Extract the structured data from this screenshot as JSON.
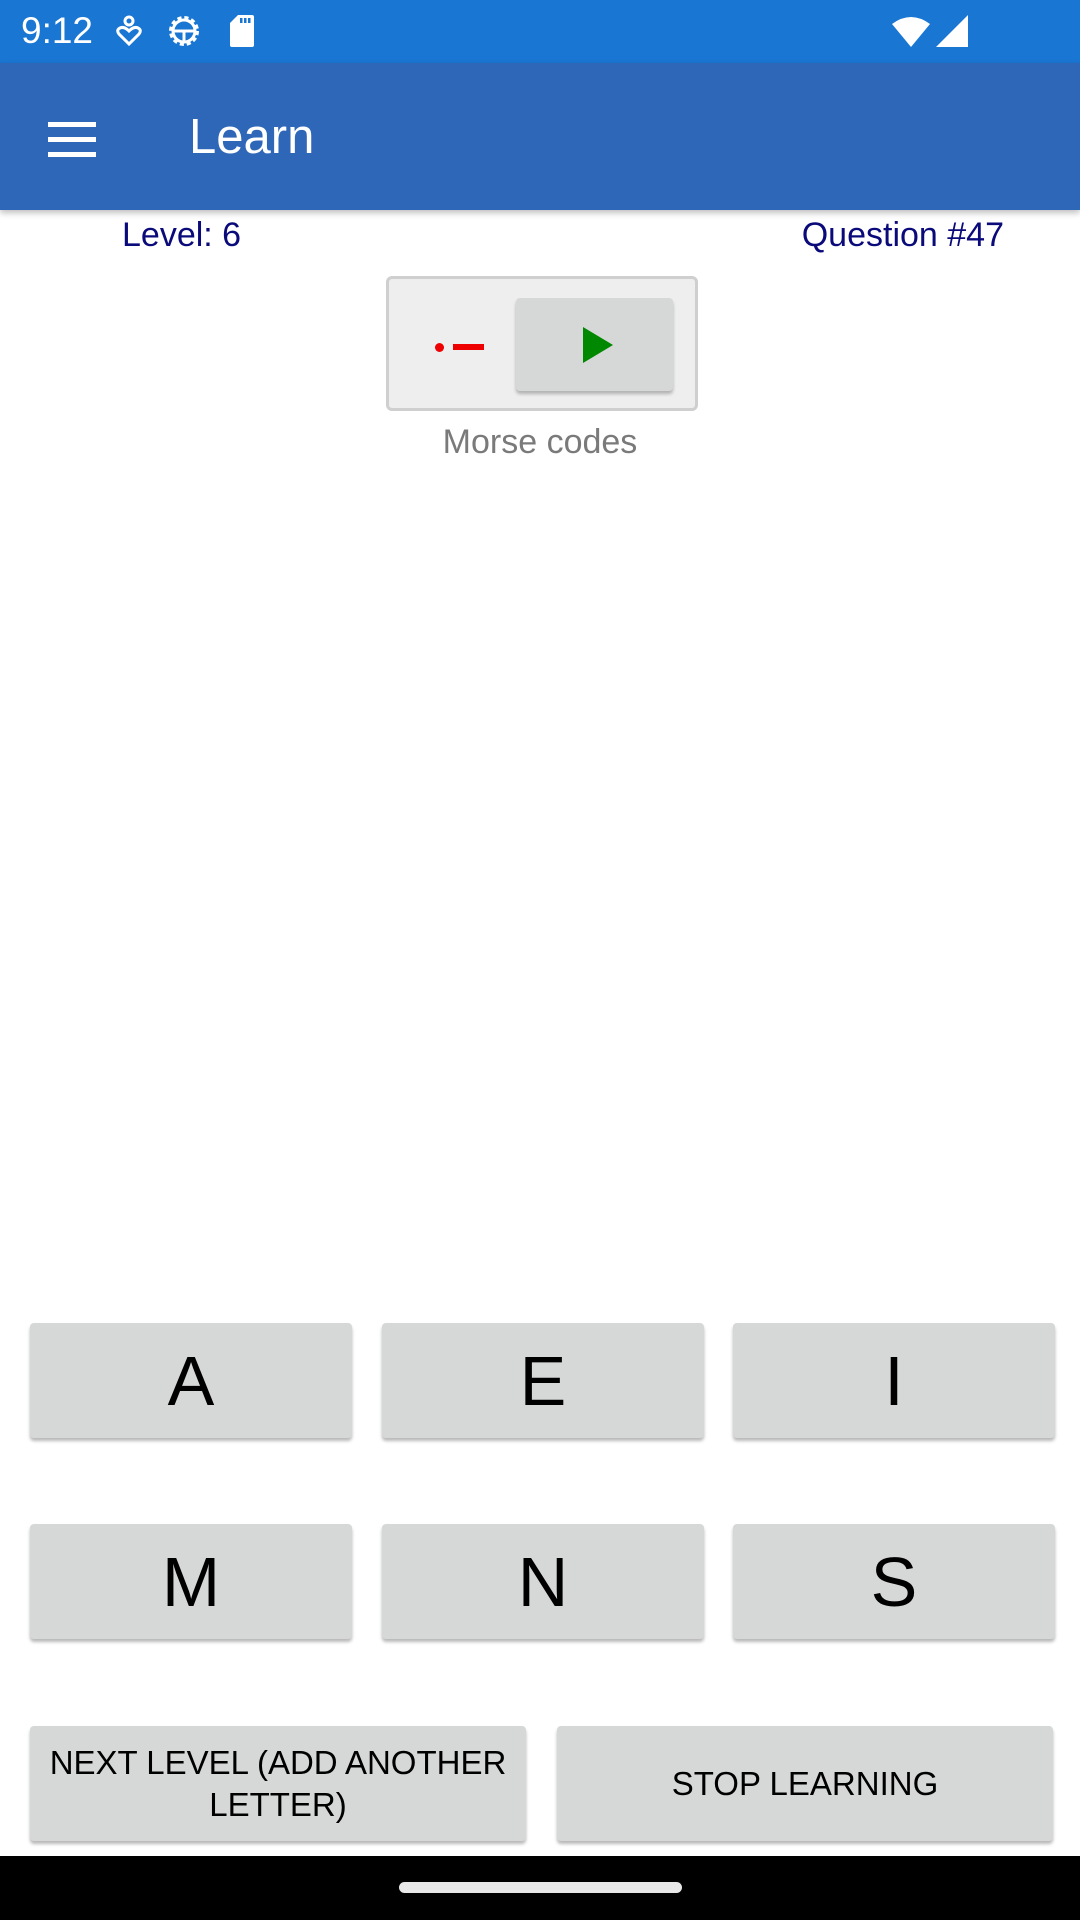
{
  "status_bar": {
    "time": "9:12",
    "left_icons": [
      "accessibility-heart-icon",
      "android-settings-gear-icon",
      "sd-card-icon"
    ],
    "right_icons": [
      "wifi-icon",
      "cellular-signal-icon"
    ]
  },
  "app_bar": {
    "menu_icon": "hamburger-menu-icon",
    "title": "Learn"
  },
  "info": {
    "level": "Level: 6",
    "question": "Question #47"
  },
  "morse": {
    "code": ".-",
    "code_color": "#ee0000",
    "play_icon": "play-icon",
    "play_color": "#008800",
    "caption": "Morse codes"
  },
  "answers": [
    "A",
    "E",
    "I",
    "M",
    "N",
    "S"
  ],
  "actions": {
    "next_level": "NEXT LEVEL (ADD ANOTHER LETTER)",
    "stop_learning": "STOP LEARNING"
  },
  "colors": {
    "status_bar": "#1976d2",
    "app_bar": "#2f67b8",
    "label_text": "#0a0a7a",
    "button_bg": "#d6d7d7"
  }
}
